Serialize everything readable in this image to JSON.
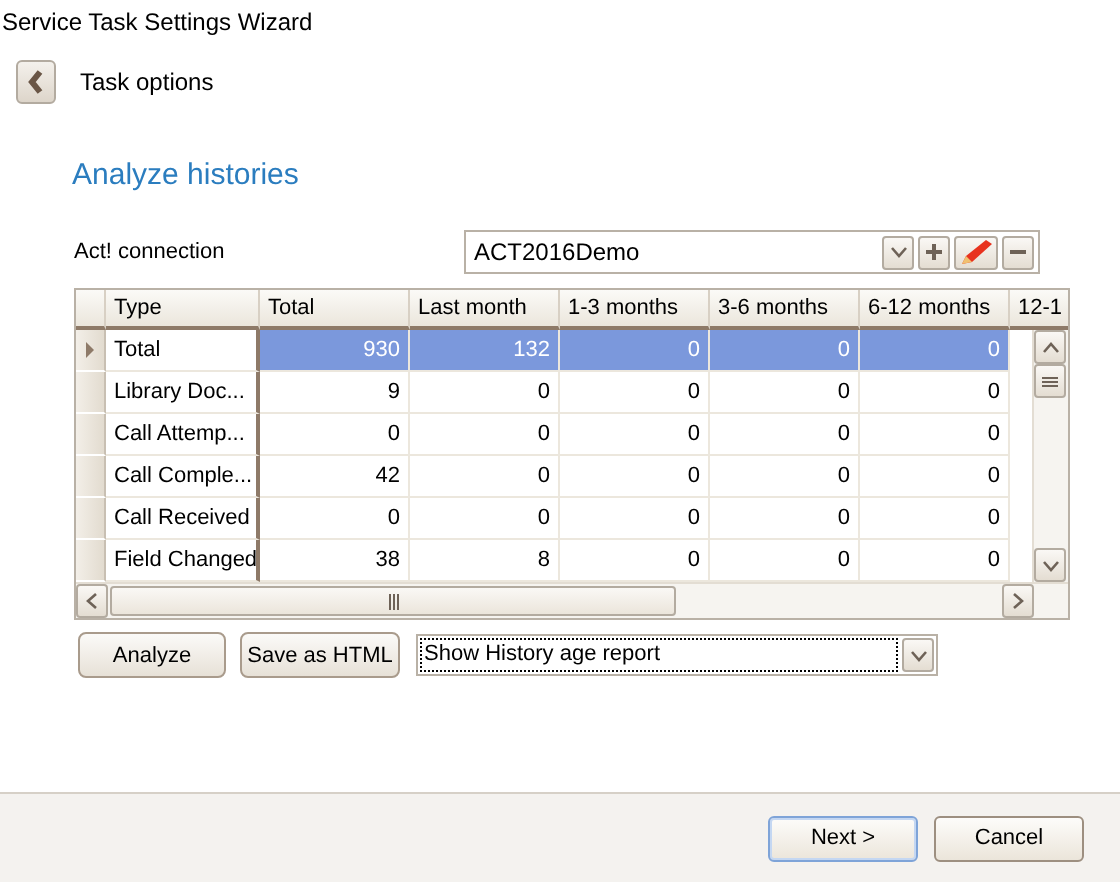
{
  "window": {
    "title": "Service Task Settings Wizard"
  },
  "page": {
    "title": "Task options",
    "heading": "Analyze histories"
  },
  "connection": {
    "label": "Act! connection",
    "value": "ACT2016Demo"
  },
  "table": {
    "columns": [
      "Type",
      "Total",
      "Last month",
      "1-3 months",
      "3-6 months",
      "6-12 months",
      "12-1"
    ],
    "rows": [
      {
        "selected": true,
        "cells": [
          "Total",
          "930",
          "132",
          "0",
          "0",
          "0"
        ]
      },
      {
        "selected": false,
        "cells": [
          "Library Doc...",
          "9",
          "0",
          "0",
          "0",
          "0"
        ]
      },
      {
        "selected": false,
        "cells": [
          "Call Attemp...",
          "0",
          "0",
          "0",
          "0",
          "0"
        ]
      },
      {
        "selected": false,
        "cells": [
          "Call Comple...",
          "42",
          "0",
          "0",
          "0",
          "0"
        ]
      },
      {
        "selected": false,
        "cells": [
          "Call Received",
          "0",
          "0",
          "0",
          "0",
          "0"
        ]
      },
      {
        "selected": false,
        "cells": [
          "Field Changed",
          "38",
          "8",
          "0",
          "0",
          "0"
        ]
      }
    ]
  },
  "actions": {
    "analyze": "Analyze",
    "save": "Save as HTML",
    "report": "Show History age report"
  },
  "footer": {
    "buttons": [
      {
        "label": "Next >",
        "kind": "primary"
      },
      {
        "label": "Cancel",
        "kind": "normal"
      }
    ]
  }
}
